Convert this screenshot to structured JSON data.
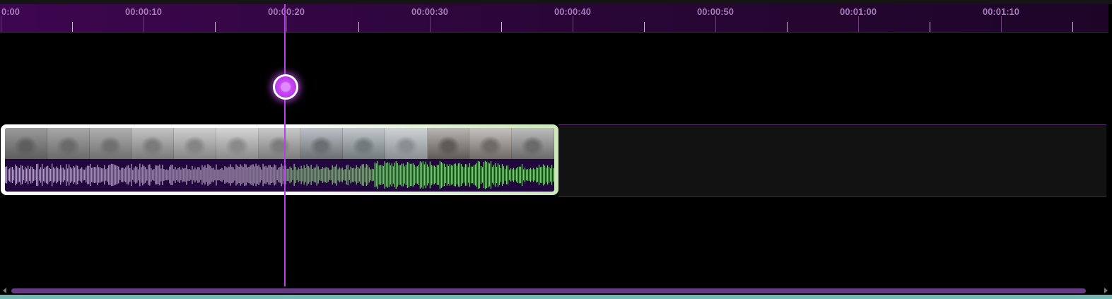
{
  "ruler": {
    "labels": [
      "0:00",
      "00:00:10",
      "00:00:20",
      "00:00:30",
      "00:00:40",
      "00:00:50",
      "00:01:00",
      "00:01:10"
    ]
  },
  "playhead": {
    "time_seconds": 20
  },
  "clip": {
    "visual": "video-thumbnails-with-audio-waveform"
  },
  "colors": {
    "accent": "#b642e6",
    "ruler_text": "#a679b9",
    "clip_border": "#ffffff",
    "waveform_played": "#b7a9c2",
    "waveform_unplayed": "#7fc77f",
    "scrollbar": "#663b82",
    "bottom_strip": "#74b8b6"
  }
}
